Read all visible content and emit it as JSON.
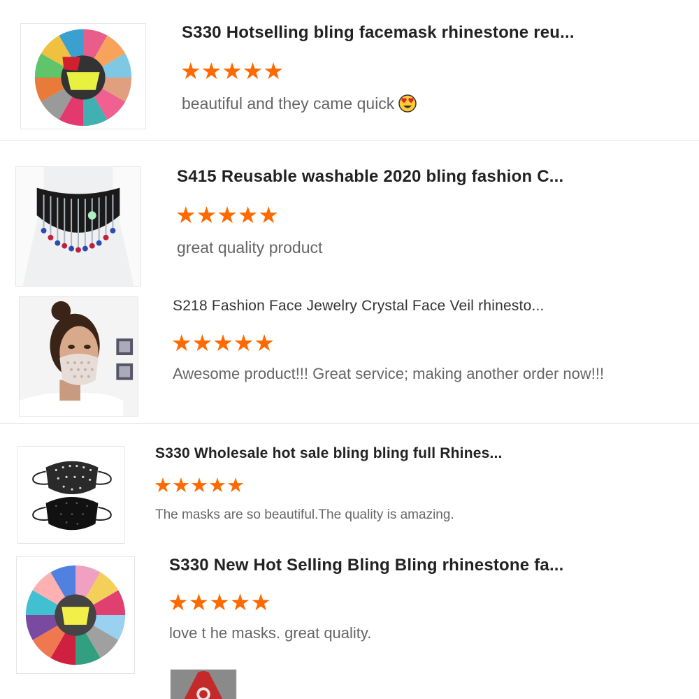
{
  "reviews": [
    {
      "title": "S330 Hotselling bling facemask rhinestone reu...",
      "rating": 5,
      "comment": "beautiful  and they came quick",
      "comment_emoji": "heart-eyes-emoji",
      "thumb_icon": "colorful-masks-fan"
    },
    {
      "title": "S415 Reusable washable 2020 bling fashion C...",
      "rating": 5,
      "comment": "great quality product",
      "thumb_icon": "rhinestone-fringe-mask-on-mannequin"
    },
    {
      "title": "S218 Fashion Face Jewelry Crystal Face Veil rhinesto...",
      "rating": 5,
      "comment": "Awesome product!!!  Great service; making another order now!!!",
      "thumb_icon": "woman-wearing-crystal-veil"
    },
    {
      "title": "S330 Wholesale hot sale bling bling full Rhines...",
      "rating": 5,
      "comment": "The masks are so beautiful.The quality is amazing.",
      "thumb_icon": "two-black-rhinestone-masks"
    },
    {
      "title": "S330 New Hot Selling Bling Bling rhinestone fa...",
      "rating": 5,
      "comment": "love t he masks. great quality.",
      "thumb_icon": "colorful-masks-fan"
    }
  ],
  "colors": {
    "star": "#ff6a00",
    "title": "#222222",
    "comment": "#666666"
  },
  "star_glyph": "★"
}
